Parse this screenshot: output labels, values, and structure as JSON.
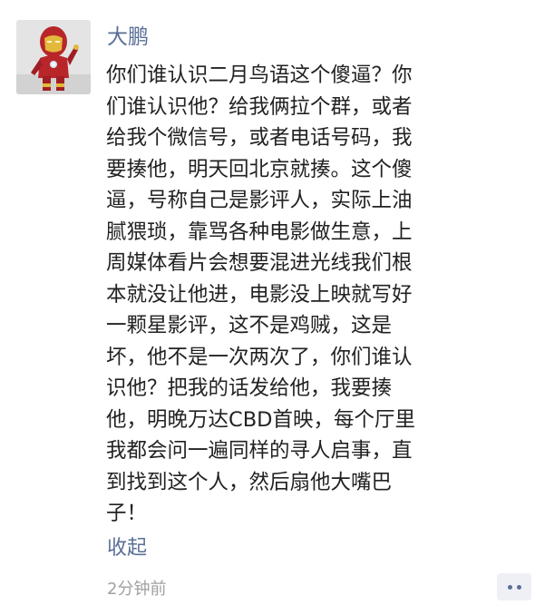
{
  "post": {
    "avatar_icon": "ironman-figure-avatar",
    "username": "大鹏",
    "message_lines": [
      "你们谁认识二月鸟语这个傻逼？你",
      "们谁认识他？给我俩拉个群，或者",
      "给我个微信号，或者电话号码，我",
      "要揍他，明天回北京就揍。这个傻",
      "逼，号称自己是影评人，实际上油",
      "腻猥琐，靠骂各种电影做生意，上",
      "周媒体看片会想要混进光线我们根",
      "本就没让他进，电影没上映就写好",
      "一颗星影评，这不是鸡贼，这是",
      "坏，他不是一次两次了，你们谁认",
      "识他？把我的话发给他，我要揍",
      "他，明晚万达CBD首映，每个厅里",
      "我都会问一遍同样的寻人启事，直",
      "到找到这个人，然后扇他大嘴巴",
      "子！"
    ],
    "collapse_label": "收起",
    "timestamp": "2分钟前"
  },
  "colors": {
    "name_link": "#5a6f96",
    "body_text": "#222222",
    "timestamp": "#a0a0a0",
    "background": "#ffffff"
  }
}
